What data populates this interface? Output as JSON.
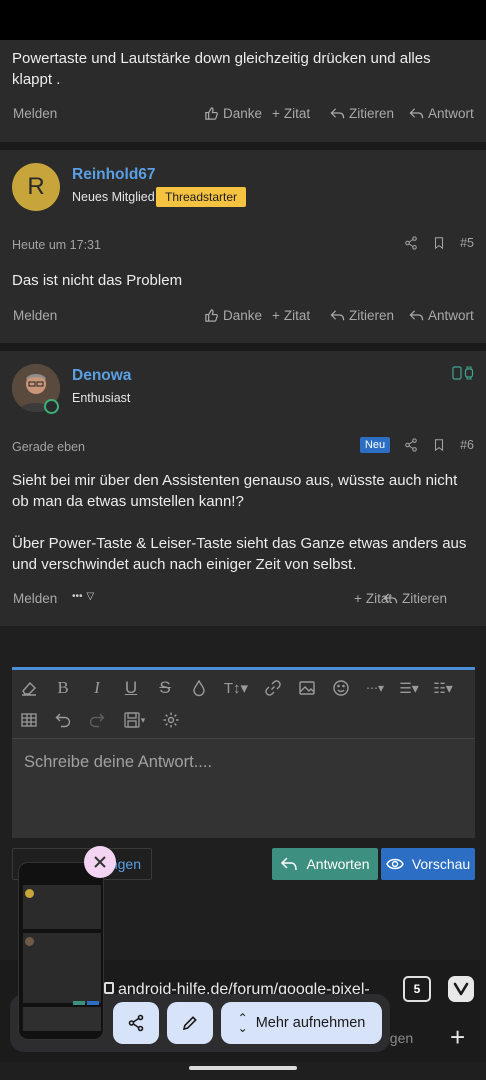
{
  "posts": [
    {
      "text": "Powertaste und Lautstärke down gleichzeitig drücken und alles klappt .",
      "actions": {
        "melden": "Melden",
        "danke": "Danke",
        "zitat": "Zitat",
        "zitieren": "Zitieren",
        "antwort": "Antwort"
      }
    },
    {
      "username": "Reinhold67",
      "avatar_letter": "R",
      "usertitle": "Neues Mitglied",
      "badge": "Threadstarter",
      "date": "Heute um 17:31",
      "number": "#5",
      "text": "Das ist nicht das Problem",
      "actions": {
        "melden": "Melden",
        "danke": "Danke",
        "zitat": "Zitat",
        "zitieren": "Zitieren",
        "antwort": "Antwort"
      }
    },
    {
      "username": "Denowa",
      "usertitle": "Enthusiast",
      "date": "Gerade eben",
      "new_badge": "Neu",
      "number": "#6",
      "text1": "Sieht bei mir über den Assistenten genauso aus, wüsste auch nicht ob man da etwas umstellen kann!?",
      "text2": "Über Power-Taste & Leiser-Taste sieht das Ganze etwas anders aus und verschwindet auch nach einiger Zeit von selbst.",
      "actions": {
        "melden": "Melden",
        "more": "•••",
        "zitat": "Zitat",
        "zitieren": "Zitieren"
      }
    }
  ],
  "editor": {
    "placeholder": "Schreibe deine Antwort....",
    "attach_partial": "ngen",
    "reply_button": "Antworten",
    "preview_button": "Vorschau"
  },
  "browser": {
    "url": "android-hilfe.de/forum/google-pixel-",
    "tab_count": "5",
    "nav_partial": "egen",
    "new_tab": "+"
  },
  "screenshot_overlay": {
    "share": "share-icon",
    "edit": "pencil-icon",
    "capture_more": "Mehr aufnehmen"
  },
  "colors": {
    "link_blue": "#5b9fe3",
    "badge_yellow": "#f5c340",
    "reply_green": "#3d8f7f",
    "preview_blue": "#2b6ec3"
  }
}
